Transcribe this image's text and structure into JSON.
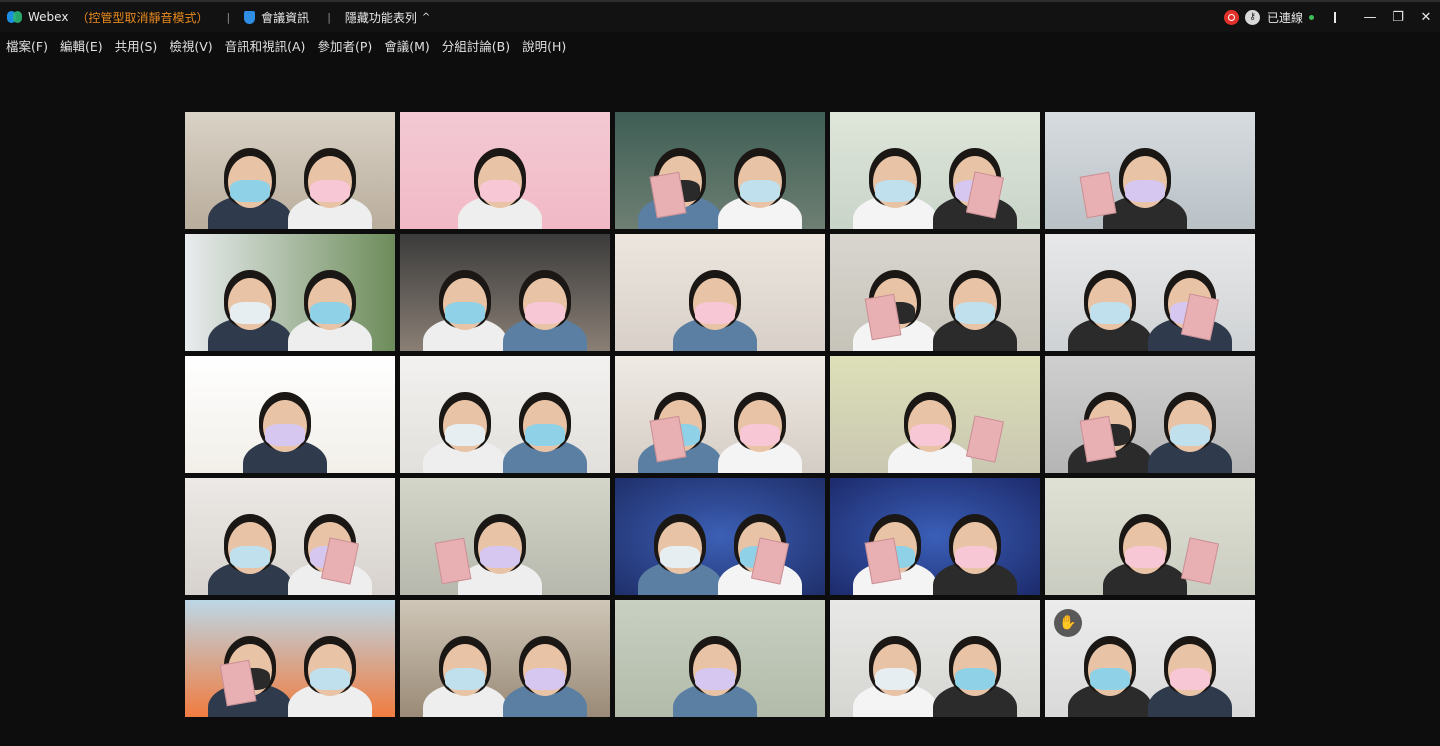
{
  "titlebar": {
    "app_name": "Webex",
    "mode": "（控管型取消靜音模式）",
    "separator": "|",
    "meeting_info": "會議資訊",
    "hide_menu": "隱藏功能表列",
    "hide_menu_chevron": "^",
    "status": "已連線",
    "controls": {
      "minimize": "—",
      "restore": "❐",
      "close": "✕"
    }
  },
  "menu": {
    "items": [
      "檔案(F)",
      "編輯(E)",
      "共用(S)",
      "檢視(V)",
      "音訊和視訊(A)",
      "參加者(P)",
      "會議(M)",
      "分組討論(B)",
      "說明(H)"
    ]
  },
  "colors": {
    "accent_orange": "#e98a1e",
    "record_red": "#e0322b",
    "connected_green": "#3fbf5a"
  },
  "icons": {
    "raise_hand": "raise-hand-icon",
    "shield": "shield-icon",
    "record": "record-icon",
    "key": "key-icon"
  }
}
